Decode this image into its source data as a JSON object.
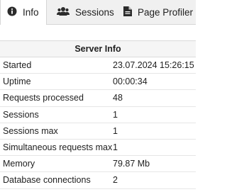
{
  "tabs": [
    {
      "label": "Info",
      "icon": "info-circle-icon",
      "active": true
    },
    {
      "label": "Sessions",
      "icon": "users-icon",
      "active": false
    },
    {
      "label": "Page Profiler",
      "icon": "file-icon",
      "active": false
    }
  ],
  "panel": {
    "title": "Server Info",
    "rows": [
      {
        "label": "Started",
        "value": "23.07.2024 15:26:15"
      },
      {
        "label": "Uptime",
        "value": "00:00:34"
      },
      {
        "label": "Requests processed",
        "value": "48"
      },
      {
        "label": "Sessions",
        "value": "1"
      },
      {
        "label": "Sessions max",
        "value": "1"
      },
      {
        "label": "Simultaneous requests max",
        "value": "1"
      },
      {
        "label": "Memory",
        "value": "79.87 Mb"
      },
      {
        "label": "Database connections",
        "value": "2"
      }
    ]
  }
}
